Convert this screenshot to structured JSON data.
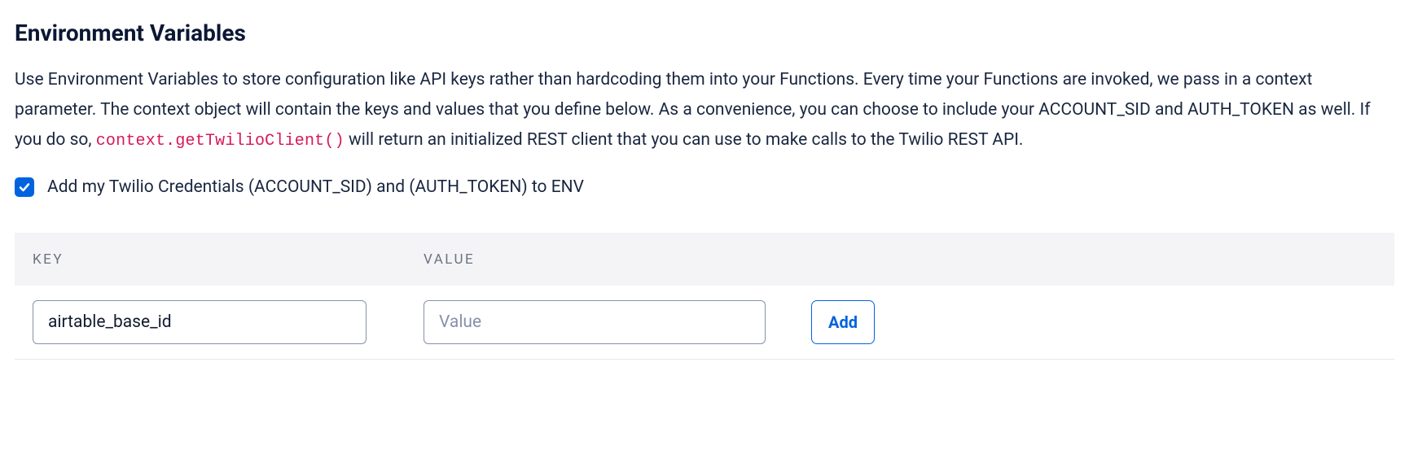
{
  "heading": "Environment Variables",
  "description": {
    "part1": "Use Environment Variables to store configuration like API keys rather than hardcoding them into your Functions. Every time your Functions are invoked, we pass in a context parameter. The context object will contain the keys and values that you define below. As a convenience, you can choose to include your ACCOUNT_SID and AUTH_TOKEN as well. If you do so, ",
    "code": "context.getTwilioClient()",
    "part2": " will return an initialized REST client that you can use to make calls to the Twilio REST API."
  },
  "checkbox": {
    "checked": true,
    "label": "Add my Twilio Credentials (ACCOUNT_SID) and (AUTH_TOKEN) to ENV"
  },
  "table": {
    "headers": {
      "key": "KEY",
      "value": "VALUE"
    },
    "row": {
      "key_value": "airtable_base_id",
      "value_placeholder": "Value",
      "value_value": ""
    }
  },
  "buttons": {
    "add": "Add"
  }
}
